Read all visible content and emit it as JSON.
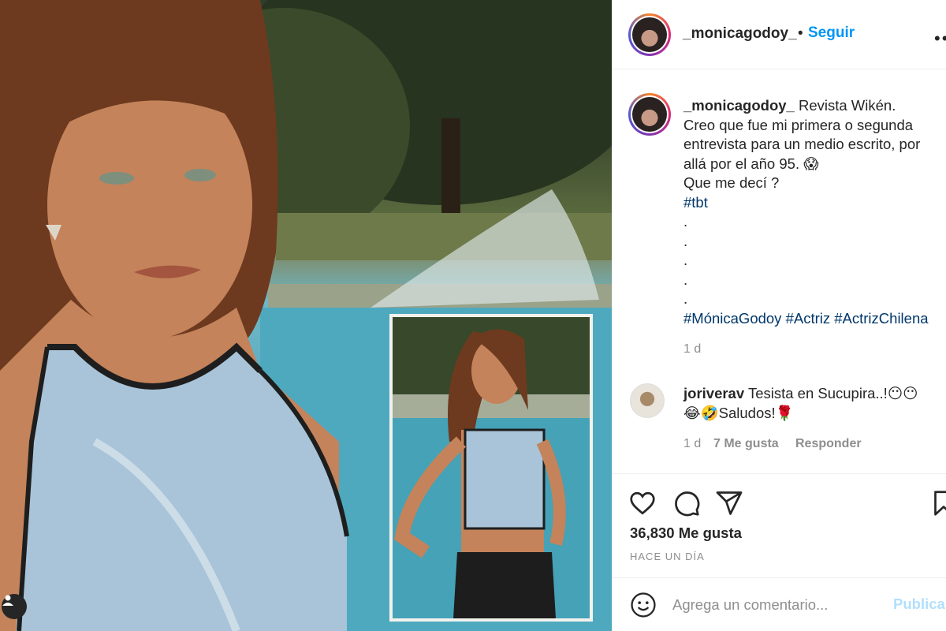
{
  "post": {
    "username": "_monicagodoy_",
    "follow_separator": "•",
    "follow_label": "Seguir",
    "more_label": "•••"
  },
  "caption": {
    "username": "_monicagodoy_",
    "line1": "Revista Wikén.",
    "line2": "Creo que fue mi primera o segunda",
    "line3": "entrevista para un medio escrito, por",
    "line4": "allá por el año 95. 😱",
    "line5": "Que me decí ?",
    "hashtag1": "#tbt",
    "dots": [
      ".",
      ".",
      ".",
      ".",
      "."
    ],
    "hashtags2": "#MónicaGodoy #Actriz #ActrizChilena",
    "time": "1 d"
  },
  "comment": {
    "username": "joriverav",
    "text": "Tesista en Sucupira..!😶😶",
    "text2": "😂🤣Saludos!🌹",
    "time": "1 d",
    "likes": "7 Me gusta",
    "reply_label": "Responder"
  },
  "actions": {
    "like_icon": "heart-icon",
    "comment_icon": "comment-bubble-icon",
    "share_icon": "paper-plane-icon",
    "save_icon": "bookmark-icon"
  },
  "likes": "36,830 Me gusta",
  "posted_ago": "HACE UN DÍA",
  "add_comment": {
    "placeholder": "Agrega un comentario...",
    "publish_label": "Publicar"
  }
}
